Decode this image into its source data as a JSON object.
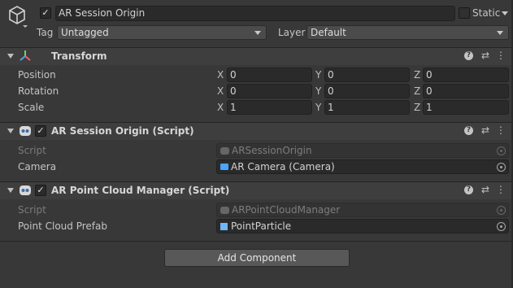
{
  "header": {
    "active": "✓",
    "name": "AR Session Origin",
    "static_label": "Static",
    "tag_label": "Tag",
    "tag_value": "Untagged",
    "layer_label": "Layer",
    "layer_value": "Default"
  },
  "transform": {
    "title": "Transform",
    "rows": [
      {
        "label": "Position",
        "x": "0",
        "y": "0",
        "z": "0"
      },
      {
        "label": "Rotation",
        "x": "0",
        "y": "0",
        "z": "0"
      },
      {
        "label": "Scale",
        "x": "1",
        "y": "1",
        "z": "1"
      }
    ],
    "axes": [
      "X",
      "Y",
      "Z"
    ]
  },
  "components": [
    {
      "enabled": "✓",
      "title": "AR Session Origin (Script)",
      "fields": [
        {
          "label": "Script",
          "value": "ARSessionOrigin",
          "disabled": true
        },
        {
          "label": "Camera",
          "value": "AR Camera (Camera)",
          "disabled": false
        }
      ]
    },
    {
      "enabled": "✓",
      "title": "AR Point Cloud Manager (Script)",
      "fields": [
        {
          "label": "Script",
          "value": "ARPointCloudManager",
          "disabled": true
        },
        {
          "label": "Point Cloud Prefab",
          "value": "PointParticle",
          "disabled": false
        }
      ]
    }
  ],
  "toolbar_icons": {
    "help": "?",
    "presets": "⇄",
    "more": "⋮"
  },
  "add_component_label": "Add Component",
  "colors": {
    "background": "#383838",
    "field": "#2a2a2a",
    "header": "#3e3e3e",
    "camera_icon": "#4aa3ff",
    "prefab_icon": "#6fb7ff"
  }
}
